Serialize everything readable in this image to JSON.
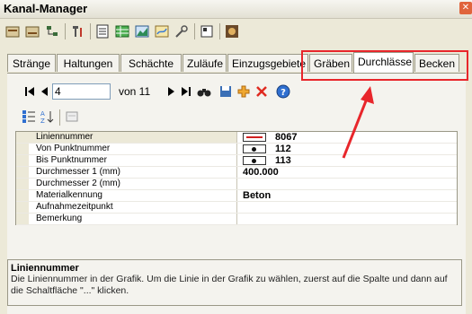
{
  "window": {
    "title": "Kanal-Manager"
  },
  "toolbar_icons": [
    "export-db-icon",
    "import-db-icon",
    "tree-icon",
    "filter-icon",
    "list-icon",
    "table-icon",
    "chart-icon",
    "map-icon",
    "tools-icon",
    "properties-icon",
    "settings-icon"
  ],
  "tabs": [
    {
      "label": "Stränge"
    },
    {
      "label": "Haltungen"
    },
    {
      "label": "Schächte"
    },
    {
      "label": "Zuläufe"
    },
    {
      "label": "Einzugsgebiete"
    },
    {
      "label": "Gräben"
    },
    {
      "label": "Durchlässe"
    },
    {
      "label": "Becken"
    }
  ],
  "active_tab": "Durchlässe",
  "navigator": {
    "current_record": "4",
    "of_label": "von 11"
  },
  "properties": [
    {
      "name": "Liniennummer",
      "value": "8067",
      "icon": "line-icon"
    },
    {
      "name": "Von Punktnummer",
      "value": "112",
      "icon": "point-icon"
    },
    {
      "name": "Bis Punktnummer",
      "value": "113",
      "icon": "point-icon"
    },
    {
      "name": "Durchmesser 1 (mm)",
      "value": "400.000",
      "icon": ""
    },
    {
      "name": "Durchmesser 2 (mm)",
      "value": "",
      "icon": ""
    },
    {
      "name": "Materialkennung",
      "value": "Beton",
      "icon": ""
    },
    {
      "name": "Aufnahmezeitpunkt",
      "value": "",
      "icon": ""
    },
    {
      "name": "Bemerkung",
      "value": "",
      "icon": ""
    }
  ],
  "description": {
    "title": "Liniennummer",
    "text": "Die Liniennummer in der Grafik. Um die Linie in der Grafik zu wählen, zuerst auf die Spalte und dann auf die Schaltfläche \"...\" klicken."
  },
  "colors": {
    "highlight": "#e8262b",
    "accent": "#d02020"
  }
}
